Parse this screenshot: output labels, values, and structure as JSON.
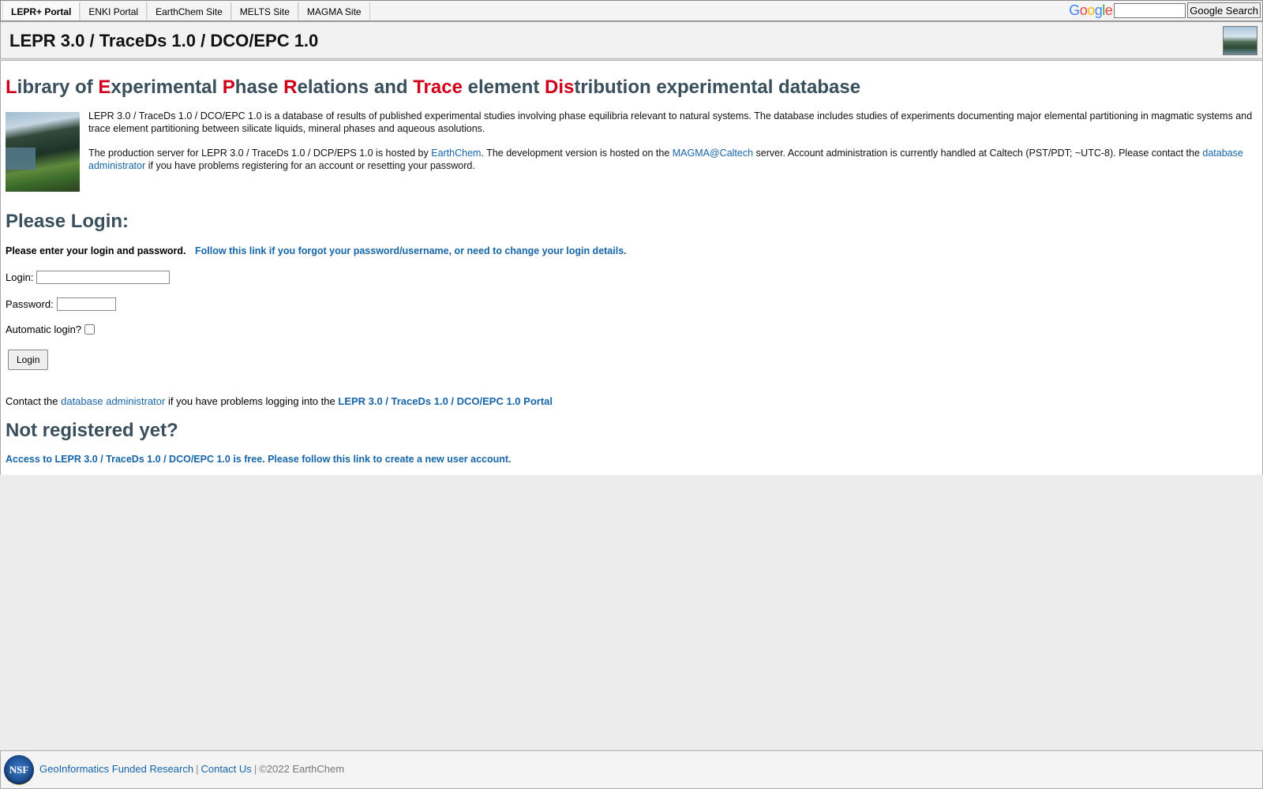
{
  "topnav": {
    "tabs": [
      {
        "label": "LEPR+ Portal",
        "active": true
      },
      {
        "label": "ENKI Portal",
        "active": false
      },
      {
        "label": "EarthChem Site",
        "active": false
      },
      {
        "label": "MELTS Site",
        "active": false
      },
      {
        "label": "MAGMA Site",
        "active": false
      }
    ],
    "google_logo": "Google",
    "search_button": "Google Search",
    "search_value": ""
  },
  "titlebar": {
    "title": "LEPR 3.0 / TraceDs 1.0 / DCO/EPC 1.0"
  },
  "headline": [
    {
      "text": "L",
      "red": true
    },
    {
      "text": "ibrary of ",
      "red": false
    },
    {
      "text": "E",
      "red": true
    },
    {
      "text": "xperimental ",
      "red": false
    },
    {
      "text": "P",
      "red": true
    },
    {
      "text": "hase ",
      "red": false
    },
    {
      "text": "R",
      "red": true
    },
    {
      "text": "elations and ",
      "red": false
    },
    {
      "text": "Trace",
      "red": true
    },
    {
      "text": " element ",
      "red": false
    },
    {
      "text": "D",
      "red": true
    },
    {
      "text": "is",
      "red": true
    },
    {
      "text": "tribution experimental database",
      "red": false
    }
  ],
  "intro": {
    "para1": "LEPR 3.0 / TraceDs 1.0 / DCO/EPC 1.0 is a database of results of published experimental studies involving phase equilibria relevant to natural systems. The database includes studies of experiments documenting major elemental partitioning in magmatic systems and trace element partitioning between silicate liquids, mineral phases and aqueous asolutions.",
    "para2_a": "The production server for LEPR 3.0 / TraceDs 1.0 / DCP/EPS 1.0 is hosted by ",
    "earthchem_link": "EarthChem",
    "para2_b": ". The development version is hosted on the ",
    "magma_link": "MAGMA@Caltech",
    "para2_c": " server. Account administration is currently handled at Caltech (PST/PDT; ~UTC-8). Please contact the ",
    "admin_link": "database administrator",
    "para2_d": " if you have problems registering for an account or resetting your password."
  },
  "login": {
    "heading": "Please Login:",
    "enter_text": "Please enter your login and password.",
    "forgot_link": "Follow this link if you forgot your password/username, or need to change your login details.",
    "login_label": "Login:",
    "login_value": "",
    "password_label": "Password:",
    "password_value": "",
    "auto_label": "Automatic login?",
    "auto_checked": false,
    "button": "Login"
  },
  "contact": {
    "prefix": "Contact the ",
    "admin_link": "database administrator",
    "middle": " if you have problems logging into the ",
    "portal_link": "LEPR 3.0 / TraceDs 1.0 / DCO/EPC 1.0 Portal"
  },
  "register": {
    "heading": "Not registered yet?",
    "link": "Access to LEPR 3.0 / TraceDs 1.0 / DCO/EPC 1.0 is free. Please follow this link to create a new user account."
  },
  "footer": {
    "nsf_text": "NSF",
    "funded_link": "GeoInformatics Funded Research",
    "sep": "|",
    "contact_link": "Contact Us",
    "copyright": "©2022 EarthChem"
  },
  "colors": {
    "heading": "#3a4f5c",
    "accent_red": "#d0021b",
    "link": "#1565a8"
  }
}
